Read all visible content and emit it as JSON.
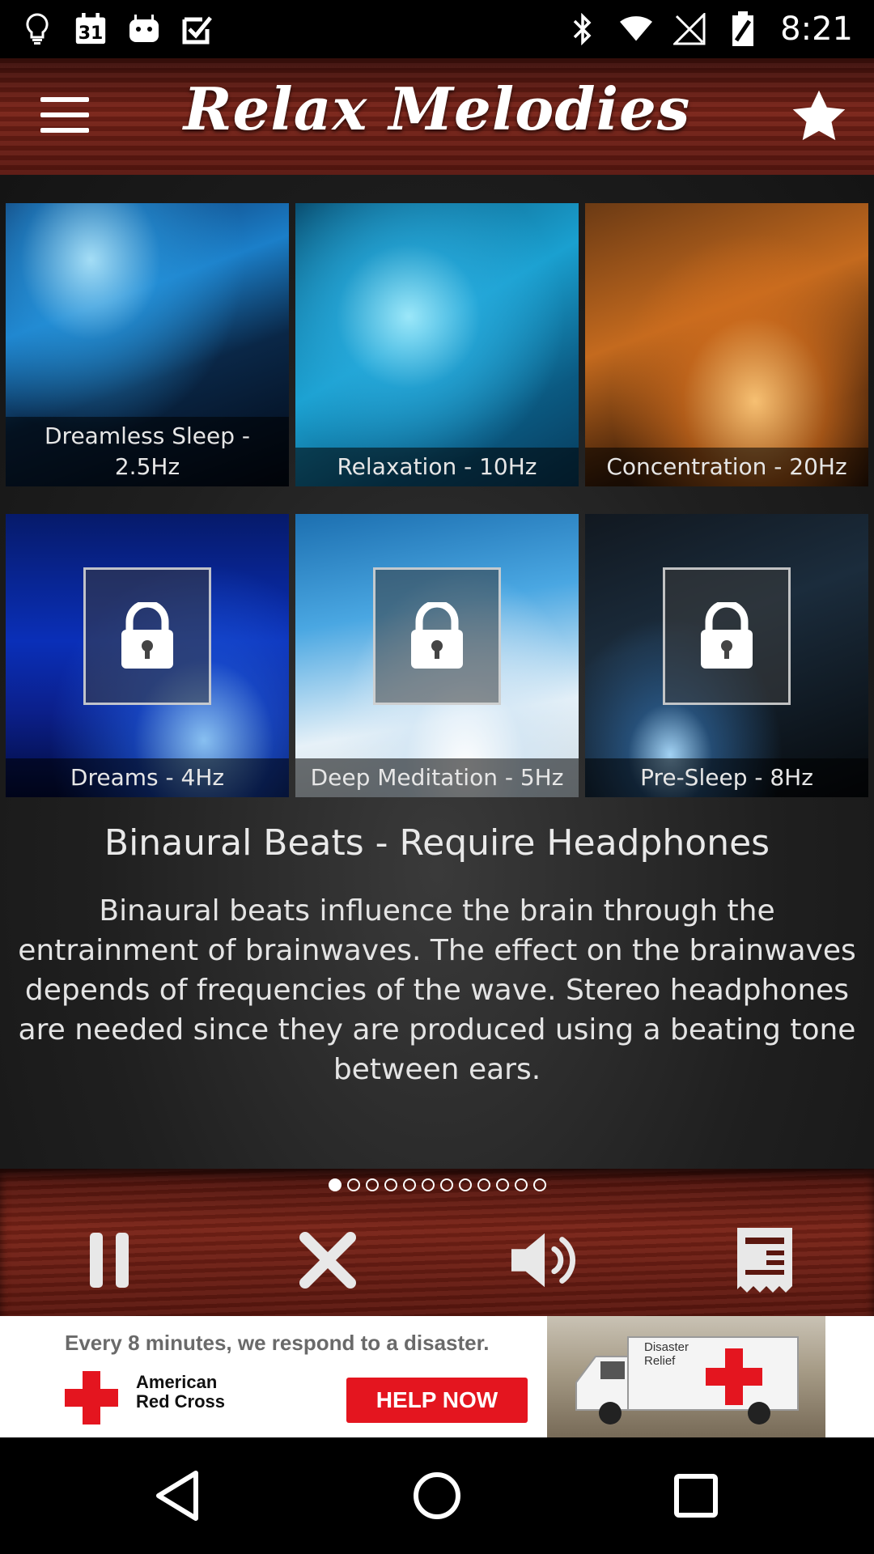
{
  "status_bar": {
    "time": "8:21",
    "calendar_day": "31",
    "icons_left": [
      "lightbulb-icon",
      "calendar-icon",
      "android-icon",
      "check-icon"
    ],
    "icons_right": [
      "bluetooth-icon",
      "wifi-icon",
      "no-signal-icon",
      "battery-icon"
    ]
  },
  "header": {
    "title": "Relax Melodies",
    "menu_icon": "hamburger-menu-icon",
    "favorite_icon": "star-icon"
  },
  "tiles": [
    {
      "label": "Dreamless Sleep - 2.5Hz",
      "locked": false
    },
    {
      "label": "Relaxation - 10Hz",
      "locked": false
    },
    {
      "label": "Concentration - 20Hz",
      "locked": false
    },
    {
      "label": "Dreams - 4Hz",
      "locked": true
    },
    {
      "label": "Deep Meditation - 5Hz",
      "locked": true
    },
    {
      "label": "Pre-Sleep - 8Hz",
      "locked": true
    }
  ],
  "section": {
    "title": "Binaural Beats - Require Headphones",
    "description": "Binaural beats influence the brain through the entrainment of brainwaves. The effect on the brainwaves depends of frequencies of the wave. Stereo headphones are needed since they are produced using a beating tone between ears."
  },
  "pager": {
    "total": 12,
    "active": 1
  },
  "controls": {
    "pause_icon": "pause-icon",
    "stop_icon": "close-icon",
    "volume_icon": "volume-icon",
    "timer_icon": "receipt-icon"
  },
  "ad": {
    "headline": "Every 8 minutes, we respond to a disaster.",
    "org": "American\nRed Cross",
    "cta": "HELP NOW",
    "vehicle_text": "Disaster\nRelief"
  },
  "colors": {
    "wood_red": "#7b2318",
    "cross_red": "#e4151f"
  },
  "navbar": [
    "back-icon",
    "home-icon",
    "recents-icon"
  ]
}
